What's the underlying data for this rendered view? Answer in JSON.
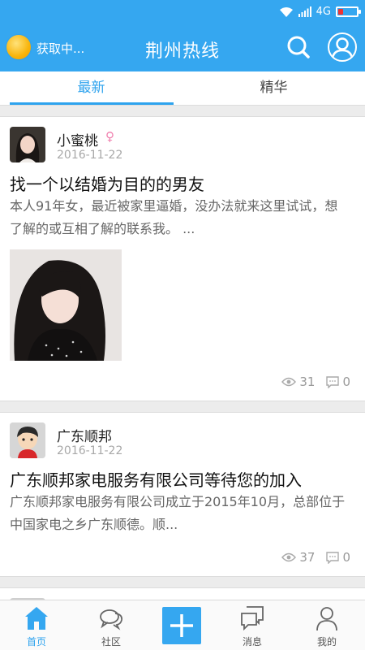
{
  "status_bar": {
    "network": "4G"
  },
  "header": {
    "weather_text": "获取中...",
    "title": "荆州热线",
    "search_icon": "search-icon",
    "profile_icon": "user-icon",
    "color": "#35a7f0"
  },
  "tabs": [
    {
      "label": "最新",
      "active": true
    },
    {
      "label": "精华",
      "active": false
    }
  ],
  "posts": [
    {
      "author": "小蜜桃",
      "gender": "female",
      "date": "2016-11-22",
      "title": "找一个以结婚为目的的男友",
      "excerpt": "本人91年女，最近被家里逼婚，没办法就来这里试试，想了解的或互相了解的联系我。 ...",
      "views": "31",
      "comments": "0"
    },
    {
      "author": "广东顺邦",
      "date": "2016-11-22",
      "title": "广东顺邦家电服务有限公司等待您的加入",
      "excerpt": "广东顺邦家电服务有限公司成立于2015年10月，总部位于中国家电之乡广东顺德。顺...",
      "views": "37",
      "comments": "0"
    }
  ],
  "bottom_nav": [
    {
      "label": "首页",
      "icon": "home-icon",
      "active": true
    },
    {
      "label": "社区",
      "icon": "chat-bubbles-icon",
      "active": false
    },
    {
      "label": "",
      "icon": "plus-icon",
      "active": false
    },
    {
      "label": "消息",
      "icon": "message-icon",
      "active": false
    },
    {
      "label": "我的",
      "icon": "person-icon",
      "active": false
    }
  ]
}
